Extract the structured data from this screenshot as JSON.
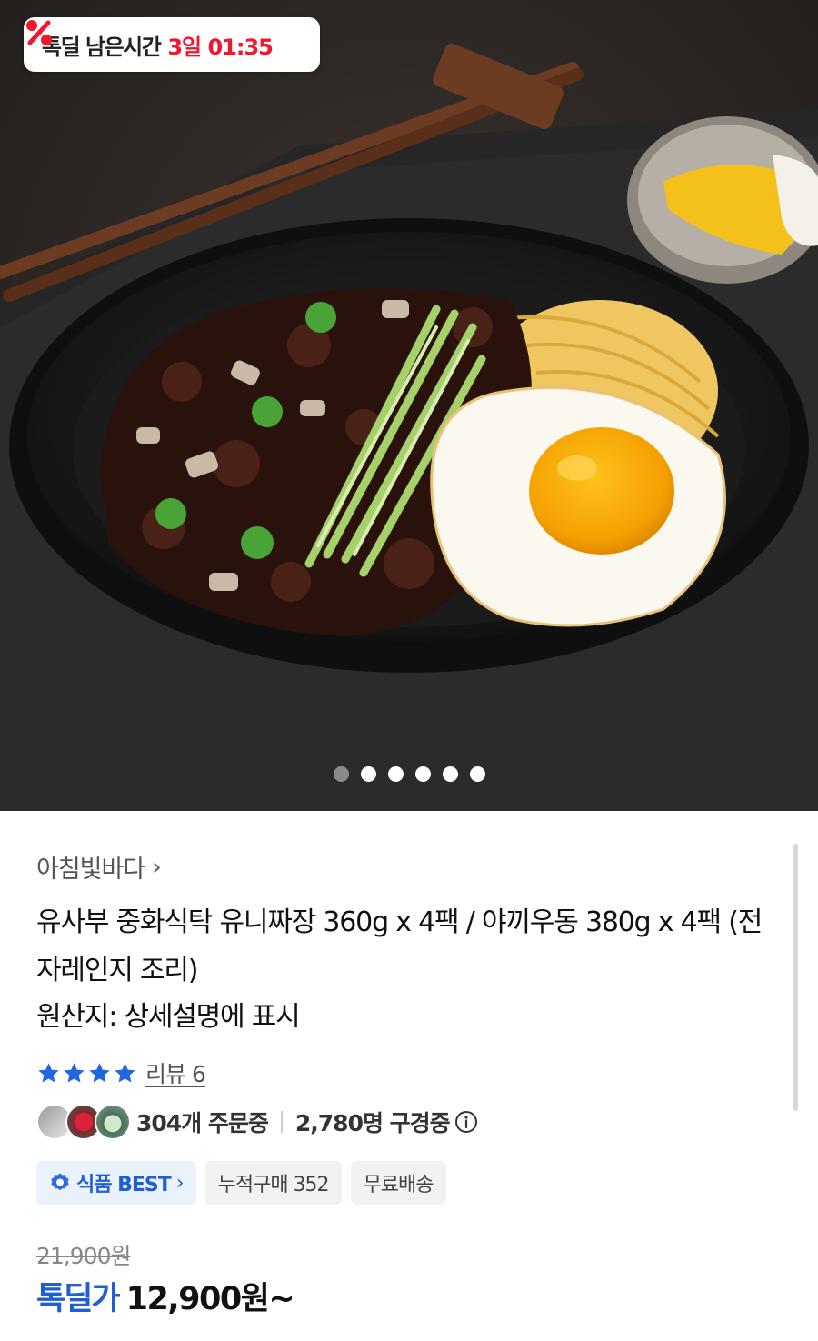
{
  "hero": {
    "timer_label": "톡딜 남은시간",
    "timer_value": "3일 01:35",
    "timer_icon": "percent-icon",
    "image_subject": "jjajang-noodle-photo",
    "carousel": {
      "count": 6,
      "active_index": 0
    }
  },
  "product": {
    "seller": "아침빛바다",
    "seller_chevron": "›",
    "title": "유사부 중화식탁 유니짜장 360g x 4팩 / 야끼우동 380g x 4팩 (전자레인지 조리)",
    "origin": "원산지: 상세설명에 표시",
    "rating": {
      "stars": 4,
      "max": 4,
      "review_text": "리뷰 6"
    },
    "orders_text": "304개 주문중",
    "viewers_text": "2,780명 구경중",
    "tags": {
      "best": "식품 BEST",
      "best_chevron": "›",
      "cumulative": "누적구매 352",
      "shipping": "무료배송"
    },
    "price": {
      "original": "21,900원",
      "deal_label": "톡딜가",
      "deal_price": "12,900원~"
    }
  },
  "colors": {
    "accent_red": "#f0172f",
    "accent_blue": "#1f5fd1",
    "star": "#1f66e0"
  }
}
